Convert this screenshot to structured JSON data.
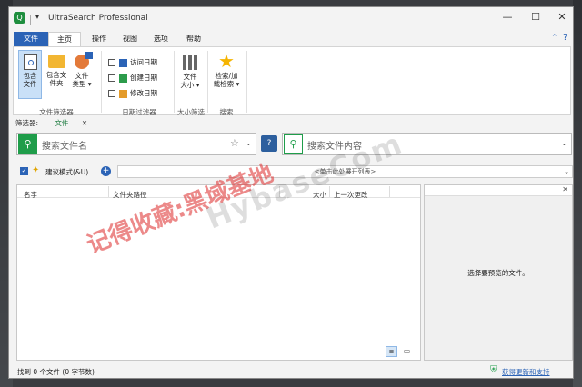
{
  "app": {
    "title": "UltraSearch Professional"
  },
  "tabs": [
    "文件",
    "主页",
    "操作",
    "视图",
    "选项",
    "帮助"
  ],
  "ribbon": {
    "contains": {
      "l1": "包含",
      "l2": "文件"
    },
    "contains_folder": {
      "l1": "包含文",
      "l2": "件夹"
    },
    "file_type": {
      "l1": "文件",
      "l2": "类型 ▾"
    },
    "group1": "文件筛选器",
    "dates": [
      "访问日期",
      "创建日期",
      "修改日期"
    ],
    "group2": "日期过滤器",
    "file_size": {
      "l1": "文件",
      "l2": "大小 ▾"
    },
    "group3": "大小筛选",
    "search_btn": {
      "l1": "检索/加",
      "l2": "载检索 ▾"
    },
    "group4": "搜索"
  },
  "filter": {
    "label": "筛选器:",
    "value": "文件"
  },
  "search": {
    "name_placeholder": "搜索文件名",
    "content_placeholder": "搜索文件内容"
  },
  "mode": {
    "label": "建议模式(&U)",
    "list_hint": "<单击此处展开列表>"
  },
  "columns": [
    "名字",
    "文件夹路径",
    "大小",
    "上一次更改"
  ],
  "preview": {
    "message": "选择要预览的文件。"
  },
  "status": {
    "text": "找到 0 个文件 (0 字节数)",
    "update_link": "获得更新和支持"
  },
  "watermark": {
    "line1": "记得收藏:黑域基地",
    "line2": "HybaseCom"
  }
}
